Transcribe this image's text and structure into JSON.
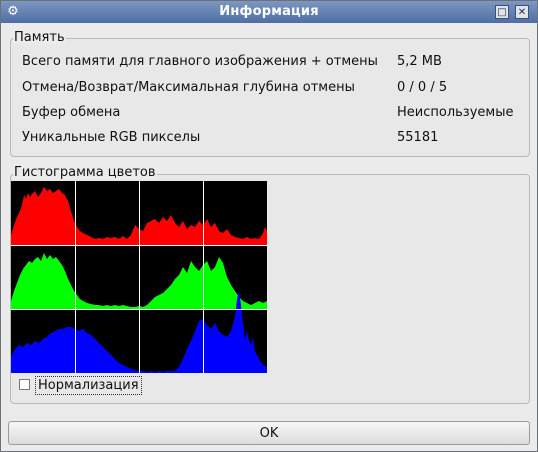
{
  "window": {
    "title": "Информация",
    "icon": "gear-icon",
    "buttons": [
      {
        "name": "maximize-icon",
        "glyph": "□"
      },
      {
        "name": "close-icon",
        "glyph": "✕"
      }
    ]
  },
  "memory": {
    "group_title": "Память",
    "rows": [
      {
        "label": "Всего памяти для главного изображения + отмены",
        "value": "5,2 MB"
      },
      {
        "label": "Отмена/Возврат/Максимальная глубина отмены",
        "value": "0 / 0 / 5"
      },
      {
        "label": "Буфер обмена",
        "value": "Неиспользуемые"
      },
      {
        "label": "Уникальные RGB пикселы",
        "value": "55181"
      }
    ]
  },
  "histogram": {
    "group_title": "Гистограмма цветов",
    "normalize_label": "Нормализация",
    "normalize_checked": false,
    "channels": [
      {
        "name": "red",
        "color": "#ff0000"
      },
      {
        "name": "green",
        "color": "#00ff00"
      },
      {
        "name": "blue",
        "color": "#0000ff"
      }
    ]
  },
  "footer": {
    "ok_label": "OK"
  }
}
